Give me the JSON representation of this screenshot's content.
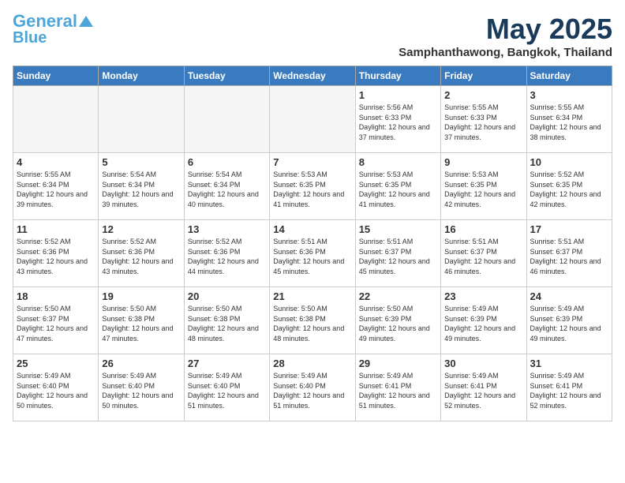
{
  "logo": {
    "line1": "General",
    "line2": "Blue"
  },
  "title": "May 2025",
  "location": "Samphanthawong, Bangkok, Thailand",
  "weekdays": [
    "Sunday",
    "Monday",
    "Tuesday",
    "Wednesday",
    "Thursday",
    "Friday",
    "Saturday"
  ],
  "weeks": [
    [
      {
        "day": "",
        "info": ""
      },
      {
        "day": "",
        "info": ""
      },
      {
        "day": "",
        "info": ""
      },
      {
        "day": "",
        "info": ""
      },
      {
        "day": "1",
        "info": "Sunrise: 5:56 AM\nSunset: 6:33 PM\nDaylight: 12 hours\nand 37 minutes."
      },
      {
        "day": "2",
        "info": "Sunrise: 5:55 AM\nSunset: 6:33 PM\nDaylight: 12 hours\nand 37 minutes."
      },
      {
        "day": "3",
        "info": "Sunrise: 5:55 AM\nSunset: 6:34 PM\nDaylight: 12 hours\nand 38 minutes."
      }
    ],
    [
      {
        "day": "4",
        "info": "Sunrise: 5:55 AM\nSunset: 6:34 PM\nDaylight: 12 hours\nand 39 minutes."
      },
      {
        "day": "5",
        "info": "Sunrise: 5:54 AM\nSunset: 6:34 PM\nDaylight: 12 hours\nand 39 minutes."
      },
      {
        "day": "6",
        "info": "Sunrise: 5:54 AM\nSunset: 6:34 PM\nDaylight: 12 hours\nand 40 minutes."
      },
      {
        "day": "7",
        "info": "Sunrise: 5:53 AM\nSunset: 6:35 PM\nDaylight: 12 hours\nand 41 minutes."
      },
      {
        "day": "8",
        "info": "Sunrise: 5:53 AM\nSunset: 6:35 PM\nDaylight: 12 hours\nand 41 minutes."
      },
      {
        "day": "9",
        "info": "Sunrise: 5:53 AM\nSunset: 6:35 PM\nDaylight: 12 hours\nand 42 minutes."
      },
      {
        "day": "10",
        "info": "Sunrise: 5:52 AM\nSunset: 6:35 PM\nDaylight: 12 hours\nand 42 minutes."
      }
    ],
    [
      {
        "day": "11",
        "info": "Sunrise: 5:52 AM\nSunset: 6:36 PM\nDaylight: 12 hours\nand 43 minutes."
      },
      {
        "day": "12",
        "info": "Sunrise: 5:52 AM\nSunset: 6:36 PM\nDaylight: 12 hours\nand 43 minutes."
      },
      {
        "day": "13",
        "info": "Sunrise: 5:52 AM\nSunset: 6:36 PM\nDaylight: 12 hours\nand 44 minutes."
      },
      {
        "day": "14",
        "info": "Sunrise: 5:51 AM\nSunset: 6:36 PM\nDaylight: 12 hours\nand 45 minutes."
      },
      {
        "day": "15",
        "info": "Sunrise: 5:51 AM\nSunset: 6:37 PM\nDaylight: 12 hours\nand 45 minutes."
      },
      {
        "day": "16",
        "info": "Sunrise: 5:51 AM\nSunset: 6:37 PM\nDaylight: 12 hours\nand 46 minutes."
      },
      {
        "day": "17",
        "info": "Sunrise: 5:51 AM\nSunset: 6:37 PM\nDaylight: 12 hours\nand 46 minutes."
      }
    ],
    [
      {
        "day": "18",
        "info": "Sunrise: 5:50 AM\nSunset: 6:37 PM\nDaylight: 12 hours\nand 47 minutes."
      },
      {
        "day": "19",
        "info": "Sunrise: 5:50 AM\nSunset: 6:38 PM\nDaylight: 12 hours\nand 47 minutes."
      },
      {
        "day": "20",
        "info": "Sunrise: 5:50 AM\nSunset: 6:38 PM\nDaylight: 12 hours\nand 48 minutes."
      },
      {
        "day": "21",
        "info": "Sunrise: 5:50 AM\nSunset: 6:38 PM\nDaylight: 12 hours\nand 48 minutes."
      },
      {
        "day": "22",
        "info": "Sunrise: 5:50 AM\nSunset: 6:39 PM\nDaylight: 12 hours\nand 49 minutes."
      },
      {
        "day": "23",
        "info": "Sunrise: 5:49 AM\nSunset: 6:39 PM\nDaylight: 12 hours\nand 49 minutes."
      },
      {
        "day": "24",
        "info": "Sunrise: 5:49 AM\nSunset: 6:39 PM\nDaylight: 12 hours\nand 49 minutes."
      }
    ],
    [
      {
        "day": "25",
        "info": "Sunrise: 5:49 AM\nSunset: 6:40 PM\nDaylight: 12 hours\nand 50 minutes."
      },
      {
        "day": "26",
        "info": "Sunrise: 5:49 AM\nSunset: 6:40 PM\nDaylight: 12 hours\nand 50 minutes."
      },
      {
        "day": "27",
        "info": "Sunrise: 5:49 AM\nSunset: 6:40 PM\nDaylight: 12 hours\nand 51 minutes."
      },
      {
        "day": "28",
        "info": "Sunrise: 5:49 AM\nSunset: 6:40 PM\nDaylight: 12 hours\nand 51 minutes."
      },
      {
        "day": "29",
        "info": "Sunrise: 5:49 AM\nSunset: 6:41 PM\nDaylight: 12 hours\nand 51 minutes."
      },
      {
        "day": "30",
        "info": "Sunrise: 5:49 AM\nSunset: 6:41 PM\nDaylight: 12 hours\nand 52 minutes."
      },
      {
        "day": "31",
        "info": "Sunrise: 5:49 AM\nSunset: 6:41 PM\nDaylight: 12 hours\nand 52 minutes."
      }
    ]
  ]
}
